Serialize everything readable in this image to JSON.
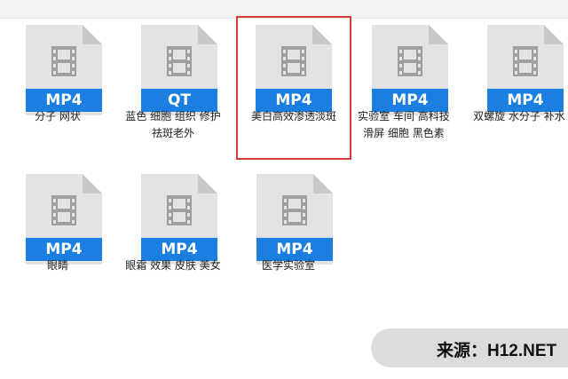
{
  "files": [
    {
      "badge": "MP4",
      "name": "分子 网状"
    },
    {
      "badge": "QT",
      "name": "蓝色 细胞 组织 修护 祛斑老外"
    },
    {
      "badge": "MP4",
      "name": "美白高效渗透淡斑",
      "selected": true
    },
    {
      "badge": "MP4",
      "name": "实验室 车间 高科技 滑屏 细胞 黑色素"
    },
    {
      "badge": "MP4",
      "name": "双螺旋 水分子 补水"
    },
    {
      "badge": "MP4",
      "name": "眼睛"
    },
    {
      "badge": "MP4",
      "name": "眼霜 效果 皮肤 美女"
    },
    {
      "badge": "MP4",
      "name": "医学实验室"
    }
  ],
  "watermark": {
    "text": "来源：H12.NET"
  },
  "colors": {
    "badge": "#1a7fe0",
    "selection": "#d93b3b"
  },
  "icons": {
    "file": "video-file-icon"
  }
}
